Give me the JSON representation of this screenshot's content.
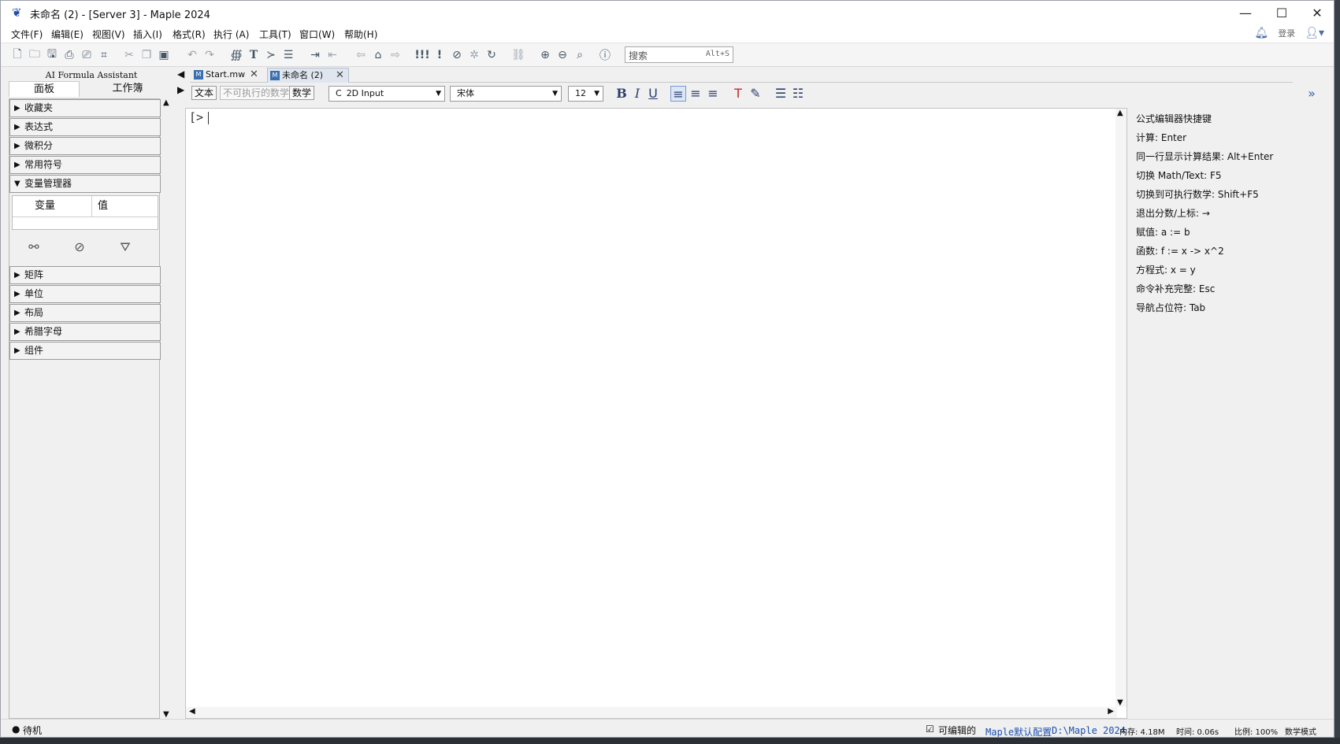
{
  "window": {
    "title": "未命名 (2) - [Server 3] - Maple 2024",
    "minimize": "—",
    "maximize": "☐",
    "close": "✕"
  },
  "menu": {
    "items": [
      "文件(F)",
      "编辑(E)",
      "视图(V)",
      "插入(I)",
      "格式(R)",
      "执行 (A)",
      "工具(T)",
      "窗口(W)",
      "帮助(H)"
    ],
    "login": "登录"
  },
  "toolbar": {
    "search_placeholder": "搜索",
    "search_shortcut": "Alt+S"
  },
  "left_panel": {
    "title": "AI Formula Assistant",
    "tabs": [
      "面板",
      "工作簿"
    ],
    "items_top": [
      "收藏夹",
      "表达式",
      "微积分",
      "常用符号"
    ],
    "expanded_item": "变量管理器",
    "var_table": {
      "col_var": "变量",
      "col_val": "值"
    },
    "items_bottom": [
      "矩阵",
      "单位",
      "布局",
      "希腊字母",
      "组件"
    ]
  },
  "doc_tabs": [
    {
      "label": "Start.mw",
      "active": false
    },
    {
      "label": "未命名 (2)",
      "active": true
    }
  ],
  "format_bar": {
    "text_btn": "文本",
    "nonexec_btn": "不可执行的数学",
    "math_btn": "数学",
    "input_mode": "2D Input",
    "font": "宋体",
    "size": "12"
  },
  "document": {
    "prompt": "[>"
  },
  "right_panel": {
    "title": "公式编辑器快捷键",
    "lines": [
      "计算:  Enter",
      "同一行显示计算结果:  Alt+Enter",
      "切换 Math/Text:  F5",
      "切换到可执行数学:  Shift+F5",
      "退出分数/上标:  →",
      "赋值:  a := b",
      "函数:  f := x -> x^2",
      "方程式:  x = y",
      "命令补充完整:  Esc",
      "导航占位符:  Tab"
    ]
  },
  "status": {
    "state": "待机",
    "editable": "可编辑的",
    "config": "Maple默认配置",
    "path": "D:\\Maple 2024",
    "memory": "内存: 4.18M",
    "time": "时间: 0.06s",
    "zoom": "比例: 100%",
    "mode": "数学模式"
  }
}
